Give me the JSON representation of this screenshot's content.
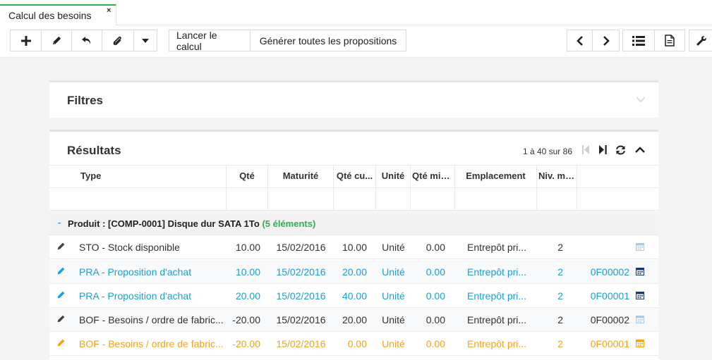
{
  "tab": {
    "title": "Calcul des besoins",
    "close": "×"
  },
  "toolbar": {
    "icons": [
      "plus-icon",
      "pencil-icon",
      "undo-icon",
      "paperclip-icon",
      "caret-down-icon"
    ],
    "launch_label": "Lancer le calcul",
    "generate_label": "Générer toutes les propositions",
    "right_icons": [
      "chevron-left-icon",
      "chevron-right-icon",
      "list-icon",
      "document-icon",
      "wrench-icon"
    ]
  },
  "filters": {
    "title": "Filtres"
  },
  "results": {
    "title": "Résultats",
    "pager": "1 à 40 sur 86",
    "columns": [
      "Type",
      "Qté",
      "Maturité",
      "Qté cu...",
      "Unité",
      "Qté min...",
      "Emplacement",
      "Niv. max"
    ],
    "group": {
      "toggle": "-",
      "label": "Produit : [COMP-0001] Disque dur SATA 1To",
      "count": "(5 éléments)"
    },
    "rows": [
      {
        "type": "STO - Stock disponible",
        "qte": "10.00",
        "maturite": "15/02/2016",
        "qte_cu": "10.00",
        "unite": "Unité",
        "qte_min": "0.00",
        "emplacement": "Entrepôt pri...",
        "niv": "2",
        "ref": "",
        "color": "gray"
      },
      {
        "type": "PRA - Proposition d'achat",
        "qte": "10.00",
        "maturite": "15/02/2016",
        "qte_cu": "20.00",
        "unite": "Unité",
        "qte_min": "0.00",
        "emplacement": "Entrepôt pri...",
        "niv": "2",
        "ref": "0F00002",
        "color": "blue"
      },
      {
        "type": "PRA - Proposition d'achat",
        "qte": "20.00",
        "maturite": "15/02/2016",
        "qte_cu": "40.00",
        "unite": "Unité",
        "qte_min": "0.00",
        "emplacement": "Entrepôt pri...",
        "niv": "2",
        "ref": "0F00001",
        "color": "blue"
      },
      {
        "type": "BOF - Besoins / ordre de fabric...",
        "qte": "-20.00",
        "maturite": "15/02/2016",
        "qte_cu": "20.00",
        "unite": "Unité",
        "qte_min": "0.00",
        "emplacement": "Entrepôt pri...",
        "niv": "2",
        "ref": "0F00002",
        "color": "gray"
      },
      {
        "type": "BOF - Besoins / ordre de fabric...",
        "qte": "-20.00",
        "maturite": "15/02/2016",
        "qte_cu": "0.00",
        "unite": "Unité",
        "qte_min": "0.00",
        "emplacement": "Entrepôt pri...",
        "niv": "2",
        "ref": "0F00001",
        "color": "orange"
      }
    ]
  },
  "colors": {
    "accent_green": "#2bb24c",
    "blue": "#1a9fd9",
    "orange": "#f5a21b",
    "gray": "#333333"
  }
}
